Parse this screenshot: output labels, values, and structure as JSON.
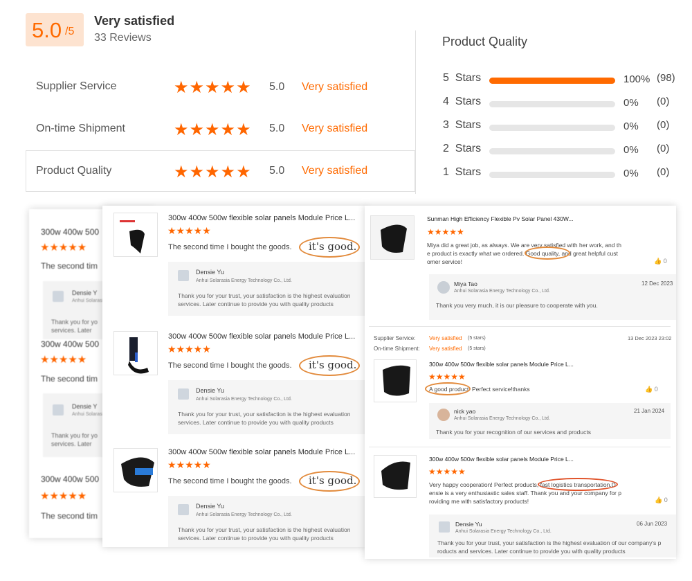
{
  "overall": {
    "score": "5.0",
    "out_of": "/5",
    "label": "Very satisfied",
    "reviews": "33 Reviews"
  },
  "category_ratings": [
    {
      "name": "Supplier Service",
      "stars": "★★★★★",
      "score": "5.0",
      "label": "Very satisfied"
    },
    {
      "name": "On-time Shipment",
      "stars": "★★★★★",
      "score": "5.0",
      "label": "Very satisfied"
    },
    {
      "name": "Product Quality",
      "stars": "★★★★★",
      "score": "5.0",
      "label": "Very satisfied"
    }
  ],
  "quality_panel": {
    "title": "Product Quality",
    "rows": [
      {
        "label": "5  Stars",
        "fraction": 1.0,
        "pct": "100%",
        "count": "(98)"
      },
      {
        "label": "4  Stars",
        "fraction": 0,
        "pct": "0%",
        "count": "(0)"
      },
      {
        "label": "3  Stars",
        "fraction": 0,
        "pct": "0%",
        "count": "(0)"
      },
      {
        "label": "2  Stars",
        "fraction": 0,
        "pct": "0%",
        "count": "(0)"
      },
      {
        "label": "1  Stars",
        "fraction": 0,
        "pct": "0%",
        "count": "(0)"
      }
    ]
  },
  "colors": {
    "accent": "#ff6a00",
    "badge_bg": "#fde3d0",
    "circle": "#e28a3b"
  },
  "back_card": {
    "items": [
      {
        "title": "300w 400w 500",
        "stars": "★★★★★",
        "text": "The second tim",
        "reply_name": "Densie Y",
        "reply_company": "Anhui Solarasi",
        "reply_body": "Thank you for yo",
        "reply_body2": "services. Later"
      },
      {
        "title": "300w 400w 500",
        "stars": "★★★★★",
        "text": "The second tim",
        "reply_name": "Densie Y",
        "reply_company": "Anhui Solarasi",
        "reply_body": "Thank you for yo",
        "reply_body2": "services. Later"
      },
      {
        "title": "300w 400w 500",
        "stars": "★★★★★",
        "text": "The second tim"
      }
    ]
  },
  "middle_card": {
    "items": [
      {
        "title": "300w 400w 500w flexible solar panels Module Price L...",
        "stars": "★★★★★",
        "text": "The second time I bought the goods.",
        "highlight": "it's good.",
        "reply_name": "Densie Yu",
        "reply_company": "Anhui Solarasia Energy Technology Co., Ltd.",
        "reply_body": "Thank you for your trust, your satisfaction is the highest evaluation",
        "reply_body2": "services. Later continue to provide you with quality products"
      },
      {
        "title": "300w 400w 500w flexible solar panels Module Price L...",
        "stars": "★★★★★",
        "text": "The second time I bought the goods.",
        "highlight": "it's good.",
        "reply_name": "Densie Yu",
        "reply_company": "Anhui Solarasia Energy Technology Co., Ltd.",
        "reply_body": "Thank you for your trust, your satisfaction is the highest evaluation",
        "reply_body2": "services. Later continue to provide you with quality products"
      },
      {
        "title": "300w 400w 500w flexible solar panels Module Price L...",
        "stars": "★★★★★",
        "text": "The second time I bought the goods.",
        "highlight": "it's good.",
        "reply_name": "Densie Yu",
        "reply_company": "Anhui Solarasia Energy Technology Co., Ltd.",
        "reply_body": "Thank you for your trust, your satisfaction is the highest evaluation",
        "reply_body2": "services. Later continue to provide you with quality products"
      }
    ]
  },
  "front_card": {
    "review1": {
      "title": "Sunman High Efficiency Flexible Pv Solar Panel 430W...",
      "stars": "★★★★★",
      "line1": "Miya did a great job, as always. We are very satisfied with her work, and th",
      "line2a": "e product is exactly what we ordered.",
      "line2b": "Good quality,",
      "line2c": " and great helpful cust",
      "line3": "omer service!",
      "likes": "0",
      "reply_name": "Miya Tao",
      "reply_company": "Anhui Solarasia Energy Technology Co., Ltd.",
      "reply_date": "12 Dec 2023",
      "reply_body": "Thank you very much, it is our pleasure to cooperate with you."
    },
    "review2": {
      "supplier_label": "Supplier Service:",
      "supplier_value": "Very satisfied",
      "supplier_stars": "(5 stars)",
      "shipment_label": "On-time Shipment:",
      "shipment_value": "Very satisfied",
      "shipment_stars": "(5 stars)",
      "date": "13 Dec 2023 23:02",
      "title": "300w 400w 500w flexible solar panels Module Price L...",
      "stars": "★★★★★",
      "highlight": "A good product",
      "text": "Perfect service!thanks",
      "likes": "0",
      "reply_name": "nick yao",
      "reply_company": "Anhui Solarasia Energy Technology Co., Ltd.",
      "reply_date": "21 Jan 2024",
      "reply_body": "Thank you for your recognition of our services and products"
    },
    "review3": {
      "title": "300w 400w 500w flexible solar panels Module Price L...",
      "stars": "★★★★★",
      "line1a": "Very happy cooperation! Perfect products,",
      "line1b": "fast logistics transportation",
      "line1c": ".D",
      "line2": "ensie is a very enthusiastic sales staff. Thank you and your company for p",
      "line3": "roviding me with satisfactory products!",
      "likes": "0",
      "reply_name": "Densie Yu",
      "reply_company": "Anhui Solarasia Energy Technology Co., Ltd.",
      "reply_date": "06 Jun 2023",
      "reply_body": "Thank you for your trust, your satisfaction is the highest evaluation of our company's p",
      "reply_body2": "roducts and services. Later continue to provide you with quality products"
    }
  }
}
